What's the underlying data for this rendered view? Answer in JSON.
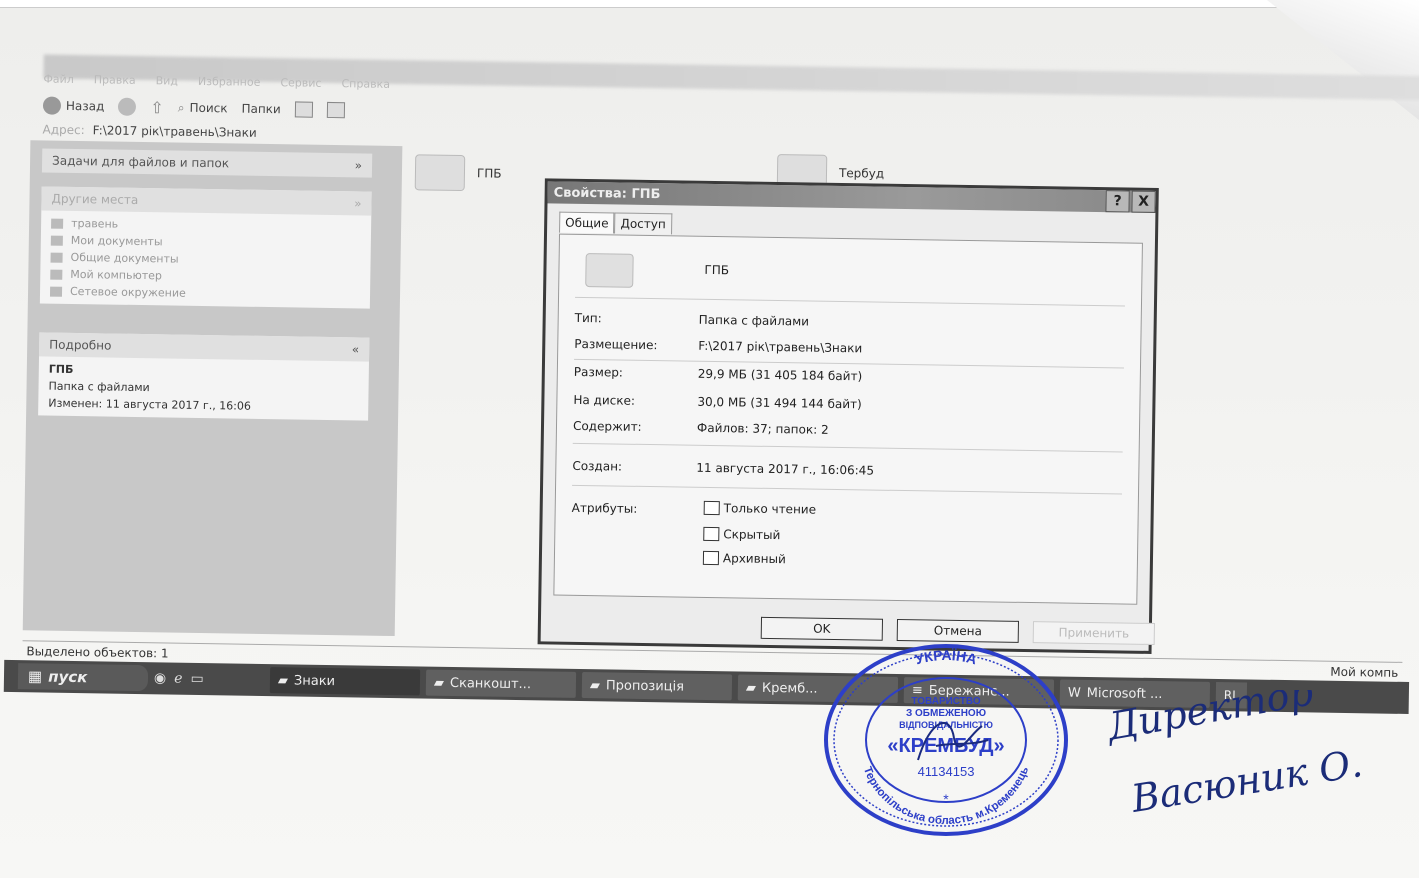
{
  "explorer": {
    "menu": [
      "Файл",
      "Правка",
      "Вид",
      "Избранное",
      "Сервис",
      "Справка"
    ],
    "toolbar": {
      "back": "Назад",
      "search": "Поиск",
      "folders": "Папки"
    },
    "address_label": "Адрес:",
    "address": "F:\\2017 рік\\травень\\Знаки",
    "tasks_title": "Задачи для файлов и папок",
    "other_places_title": "Другие места",
    "other_places": [
      "травень",
      "Мои документы",
      "Общие документы",
      "Мой компьютер",
      "Сетевое окружение"
    ],
    "details_title": "Подробно",
    "details_name": "ГПБ",
    "details_type": "Папка с файлами",
    "details_modified": "Изменен: 11 августа 2017 г., 16:06",
    "folders": [
      "ГПБ",
      "Тербуд"
    ],
    "status_text": "Выделено объектов: 1",
    "status_right": "Мой компь"
  },
  "dialog": {
    "title": "Свойства: ГПБ",
    "tabs": [
      "Общие",
      "Доступ"
    ],
    "name": "ГПБ",
    "rows": [
      {
        "label": "Тип:",
        "value": "Папка с файлами"
      },
      {
        "label": "Размещение:",
        "value": "F:\\2017 рік\\травень\\Знаки"
      },
      {
        "label": "Размер:",
        "value": "29,9 МБ (31 405 184 байт)"
      },
      {
        "label": "На диске:",
        "value": "30,0 МБ (31 494 144 байт)"
      },
      {
        "label": "Содержит:",
        "value": "Файлов: 37; папок: 2"
      },
      {
        "label": "Создан:",
        "value": "11 августа 2017 г., 16:06:45"
      }
    ],
    "attributes_label": "Атрибуты:",
    "attributes": [
      "Только чтение",
      "Скрытый",
      "Архивный"
    ],
    "buttons": {
      "ok": "OK",
      "cancel": "Отмена",
      "apply": "Применить"
    },
    "help": "?",
    "close": "X"
  },
  "taskbar": {
    "start": "пуск",
    "tasks": [
      "Знаки",
      "Сканкошт...",
      "Пропозиція",
      "Кремб...",
      "Бережанс...",
      "Microsoft ..."
    ],
    "tray": "RL"
  },
  "stamp": {
    "top": "УКРАЇНА",
    "line1": "ТОВАРИСТВО",
    "line2": "З ОБМЕЖЕНОЮ",
    "line3": "ВІДПОВІДАЛЬНІСТЮ",
    "name": "«КРЕМБУД»",
    "code": "41134153",
    "bottom": "Тернопільська область м.Кременець"
  },
  "signature": {
    "line1": "Директор",
    "line2": "Васюник О."
  }
}
